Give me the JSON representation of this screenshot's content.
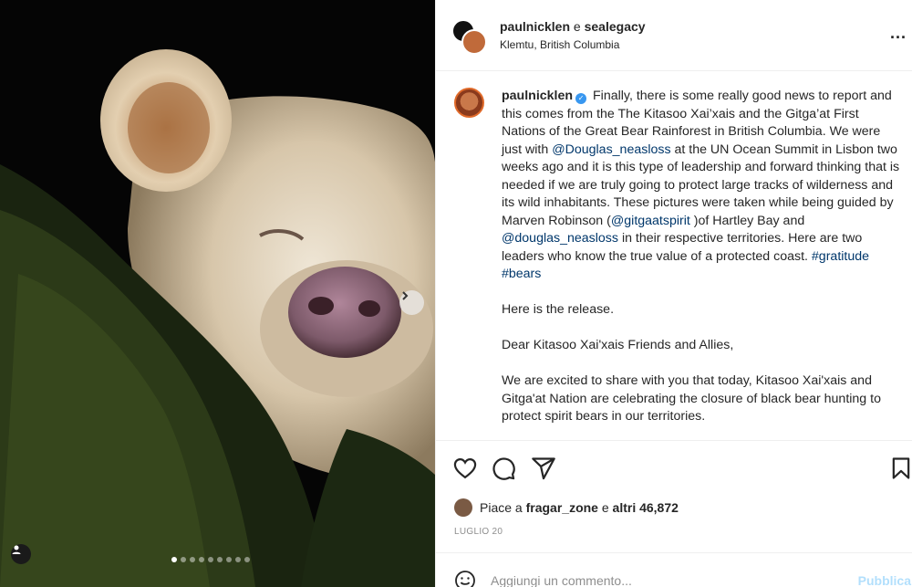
{
  "header": {
    "user_primary": "paulnicklen",
    "and_word": "e",
    "user_secondary": "sealegacy",
    "location": "Klemtu, British Columbia",
    "more_label": "..."
  },
  "caption": {
    "username": "paulnicklen",
    "verified_mark": "✓",
    "seg1": "Finally, there is some really good news to report and this comes from the The Kitasoo Xai’xais and the Gitga’at First Nations of the Great Bear Rainforest in British Columbia. We were just with ",
    "mention1": "@Douglas_neasloss",
    "seg2": " at the UN Ocean Summit in Lisbon two weeks ago and it is this type of leadership and forward thinking that is needed if we are truly going to protect large tracks of wilderness and its wild inhabitants. These pictures were taken while being guided by Marven Robinson (",
    "mention2": "@gitgaatspirit",
    "seg3": " )of Hartley Bay and ",
    "mention3": "@douglas_neasloss",
    "seg4": " in their respective territories. Here are two leaders who know the true value of a protected coast. ",
    "hashtag1": "#gratitude",
    "hashtag2": "#bears",
    "para2": "Here is the release.",
    "para3": "Dear Kitasoo Xai'xais Friends and Allies,",
    "para4": "We are excited to share with you that today, Kitasoo Xai'xais and Gitga'at Nation are celebrating the closure of black bear hunting to protect spirit bears in our territories."
  },
  "likes": {
    "prefix": "Piace a",
    "user": "fragar_zone",
    "and_word": "e",
    "others": "altri 46,872"
  },
  "date": "LUGLIO 20",
  "comment": {
    "placeholder": "Aggiungi un commento...",
    "publish_label": "Pubblica"
  },
  "carousel": {
    "slide_count": 9,
    "current": 1
  },
  "icons": [
    "heart-icon",
    "comment-icon",
    "share-icon",
    "bookmark-icon",
    "emoji-icon",
    "chevron-right-icon",
    "user-tag-icon"
  ],
  "colors": {
    "link": "#00376b",
    "verified": "#3897f0",
    "publish_disabled": "#b2dffc",
    "muted": "#8e8e8e"
  }
}
